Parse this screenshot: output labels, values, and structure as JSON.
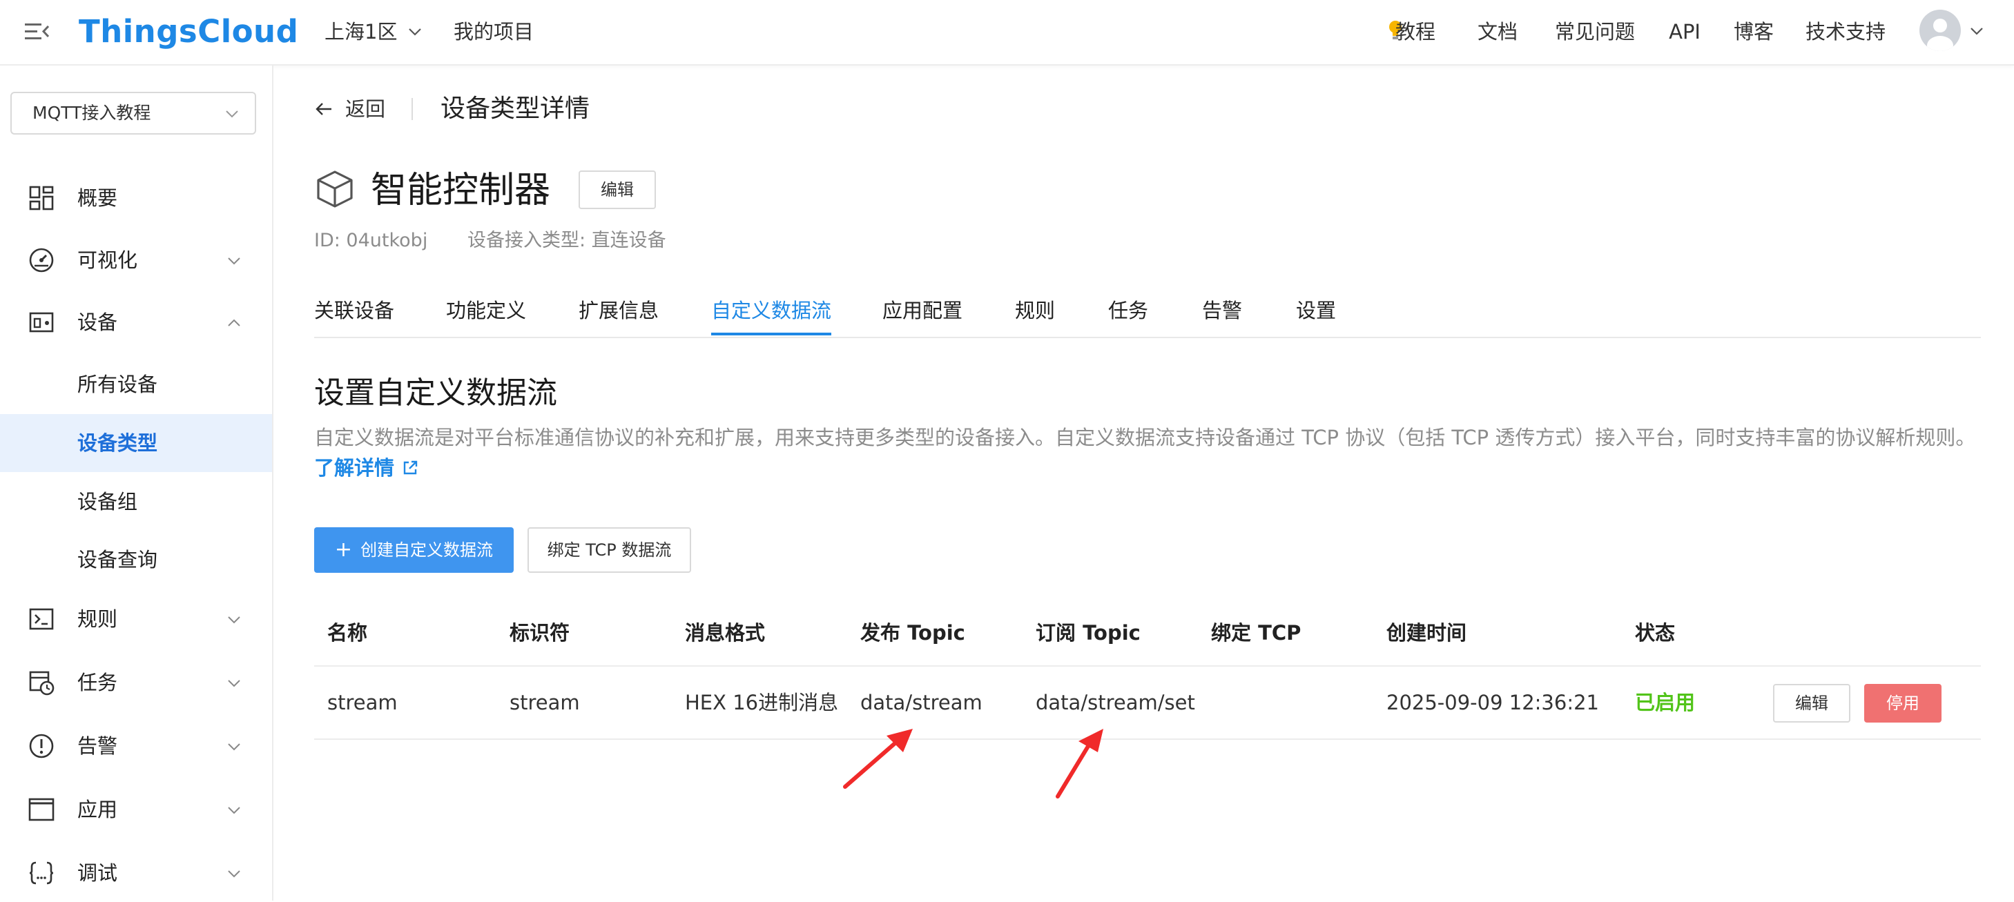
{
  "header": {
    "brand": "ThingsCloud",
    "region": "上海1区",
    "projects": "我的项目",
    "nav": [
      "教程",
      "文档",
      "常见问题",
      "API",
      "博客",
      "技术支持"
    ],
    "tutorial_icon": "lightbulb-icon",
    "avatar_icon": "user-avatar-icon"
  },
  "sidebar": {
    "project": "MQTT接入教程",
    "items": [
      {
        "label": "概要",
        "icon": "dashboard-grid-icon"
      },
      {
        "label": "可视化",
        "icon": "gauge-icon"
      },
      {
        "label": "设备",
        "icon": "devices-icon"
      },
      {
        "label": "规则",
        "icon": "terminal-icon"
      },
      {
        "label": "任务",
        "icon": "task-clock-icon"
      },
      {
        "label": "告警",
        "icon": "alert-circle-icon"
      },
      {
        "label": "应用",
        "icon": "window-icon"
      },
      {
        "label": "调试",
        "icon": "braces-icon"
      }
    ],
    "device_sub": [
      "所有设备",
      "设备类型",
      "设备组",
      "设备查询"
    ],
    "active_sub": "设备类型"
  },
  "main": {
    "back_label": "返回",
    "page_title": "设备类型详情",
    "device_name": "智能控制器",
    "edit_label": "编辑",
    "device_id": "ID: 04utkobj",
    "access_type": "设备接入类型: 直连设备",
    "tabs": [
      "关联设备",
      "功能定义",
      "扩展信息",
      "自定义数据流",
      "应用配置",
      "规则",
      "任务",
      "告警",
      "设置"
    ],
    "active_tab": "自定义数据流",
    "section_title": "设置自定义数据流",
    "description": "自定义数据流是对平台标准通信协议的补充和扩展，用来支持更多类型的设备接入。自定义数据流支持设备通过 TCP 协议（包括 TCP 透传方式）接入平台，同时支持丰富的协议解析规则。",
    "learn_more": "了解详情",
    "create_button": "创建自定义数据流",
    "bind_button": "绑定 TCP 数据流",
    "table": {
      "headers": [
        "名称",
        "标识符",
        "消息格式",
        "发布 Topic",
        "订阅 Topic",
        "绑定 TCP",
        "创建时间",
        "状态"
      ],
      "rows": [
        {
          "name": "stream",
          "identifier": "stream",
          "format": "HEX 16进制消息",
          "publish_topic": "data/stream",
          "subscribe_topic": "data/stream/set",
          "bind_tcp": "",
          "created": "2025-09-09 12:36:21",
          "status": "已启用",
          "edit": "编辑",
          "disable": "停用"
        }
      ]
    },
    "annotation_color": "#f02a2a"
  },
  "colors": {
    "accent": "#1e88e5",
    "primary_button": "#3f95ef",
    "status_enabled": "#52c41a",
    "danger_button": "#f07171",
    "active_menu_bg": "#e8f1fd"
  }
}
